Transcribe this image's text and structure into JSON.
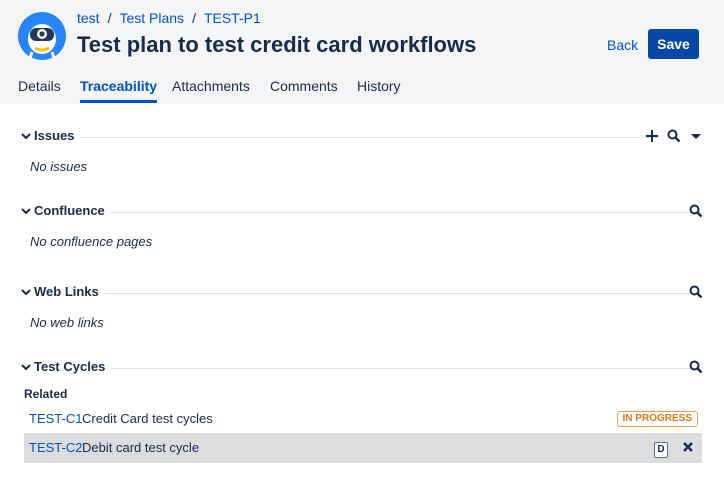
{
  "breadcrumb": {
    "project": "test",
    "section": "Test Plans",
    "item": "TEST-P1",
    "separator": "/"
  },
  "page": {
    "title": "Test plan to test credit card workflows"
  },
  "actions": {
    "back_label": "Back",
    "save_label": "Save"
  },
  "tabs": [
    {
      "label": "Details",
      "active": false
    },
    {
      "label": "Traceability",
      "active": true
    },
    {
      "label": "Attachments",
      "active": false
    },
    {
      "label": "Comments",
      "active": false
    },
    {
      "label": "History",
      "active": false
    }
  ],
  "sections": {
    "issues": {
      "title": "Issues",
      "empty_text": "No issues"
    },
    "confluence": {
      "title": "Confluence",
      "empty_text": "No confluence pages"
    },
    "weblinks": {
      "title": "Web Links",
      "empty_text": "No web links"
    },
    "testcycles": {
      "title": "Test Cycles",
      "related_label": "Related",
      "rows": [
        {
          "key": "TEST-C1",
          "name": "Credit Card test cycles",
          "status": "IN PROGRESS"
        },
        {
          "key": "TEST-C2",
          "name": "Debit card test cycle",
          "status": "D"
        }
      ]
    }
  },
  "icons": {
    "avatar": "project-avatar-icon",
    "add": "plus-icon",
    "search": "search-icon",
    "dropdown": "caret-down-icon",
    "collapse": "chevron-down-icon",
    "remove": "close-icon"
  },
  "colors": {
    "link": "#0052cc",
    "primary_button": "#0747a6",
    "header_bg": "#f4f5f7",
    "status_in_progress": "#d87919",
    "row_hover": "#dcdcdc"
  }
}
